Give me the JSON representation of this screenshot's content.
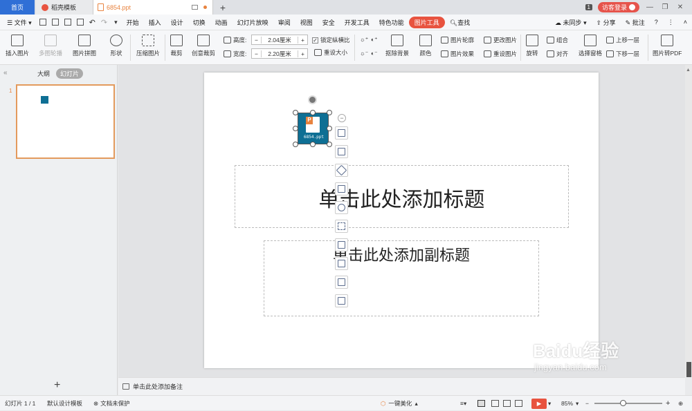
{
  "tabs": {
    "home": "首页",
    "daoke": "稻壳模板",
    "file": "6854.ppt",
    "new_tab": "+"
  },
  "top_right": {
    "window_count": "1",
    "login": "访客登录"
  },
  "menu": [
    "开始",
    "插入",
    "设计",
    "切换",
    "动画",
    "幻灯片放映",
    "审阅",
    "视图",
    "安全",
    "开发工具",
    "特色功能",
    "图片工具"
  ],
  "menu_file": "文件",
  "menu_search": "查找",
  "menu_right": {
    "sync": "未同步",
    "share": "分享",
    "comment": "批注"
  },
  "ribbon": {
    "insert_pic": "插入图片",
    "multi_contour": "多图轮播",
    "pic_collage": "图片拼图",
    "shape": "形状",
    "compress": "压缩图片",
    "crop": "裁剪",
    "creative_crop": "创意裁剪",
    "height_label": "高度:",
    "height_value": "2.04厘米",
    "width_label": "宽度:",
    "width_value": "2.20厘米",
    "lock_ratio": "锁定纵横比",
    "reset_size": "重设大小",
    "remove_bg": "抠除背景",
    "color": "颜色",
    "pic_outline": "图片轮廓",
    "pic_effect": "图片效果",
    "change_pic": "更改图片",
    "reset_pic": "重设图片",
    "rotate": "旋转",
    "group": "组合",
    "align": "对齐",
    "select_pane": "选择窗格",
    "bring_forward": "上移一层",
    "send_backward": "下移一层",
    "pic_to_pdf": "图片转PDF"
  },
  "panel": {
    "outline_tab": "大纲",
    "slides_tab": "幻灯片",
    "slide_number": "1",
    "add_slide": "+"
  },
  "slide": {
    "icon_caption": "6854.ppt",
    "title_placeholder": "单击此处添加标题",
    "subtitle_placeholder": "单击此处添加副标题"
  },
  "notes_placeholder": "单击此处添加备注",
  "status": {
    "slide_index": "幻灯片 1 / 1",
    "template": "默认设计模板",
    "protect": "文档未保护",
    "beautify": "一键美化",
    "zoom": "85%"
  },
  "watermark": {
    "brand": "Baidu经验",
    "url": "jingyan.baidu.com"
  },
  "colors": {
    "accent": "#e8533f",
    "selected_border": "#e39a5c",
    "icon_bg": "#0e6f94",
    "home_tab": "#2f6fd6"
  }
}
